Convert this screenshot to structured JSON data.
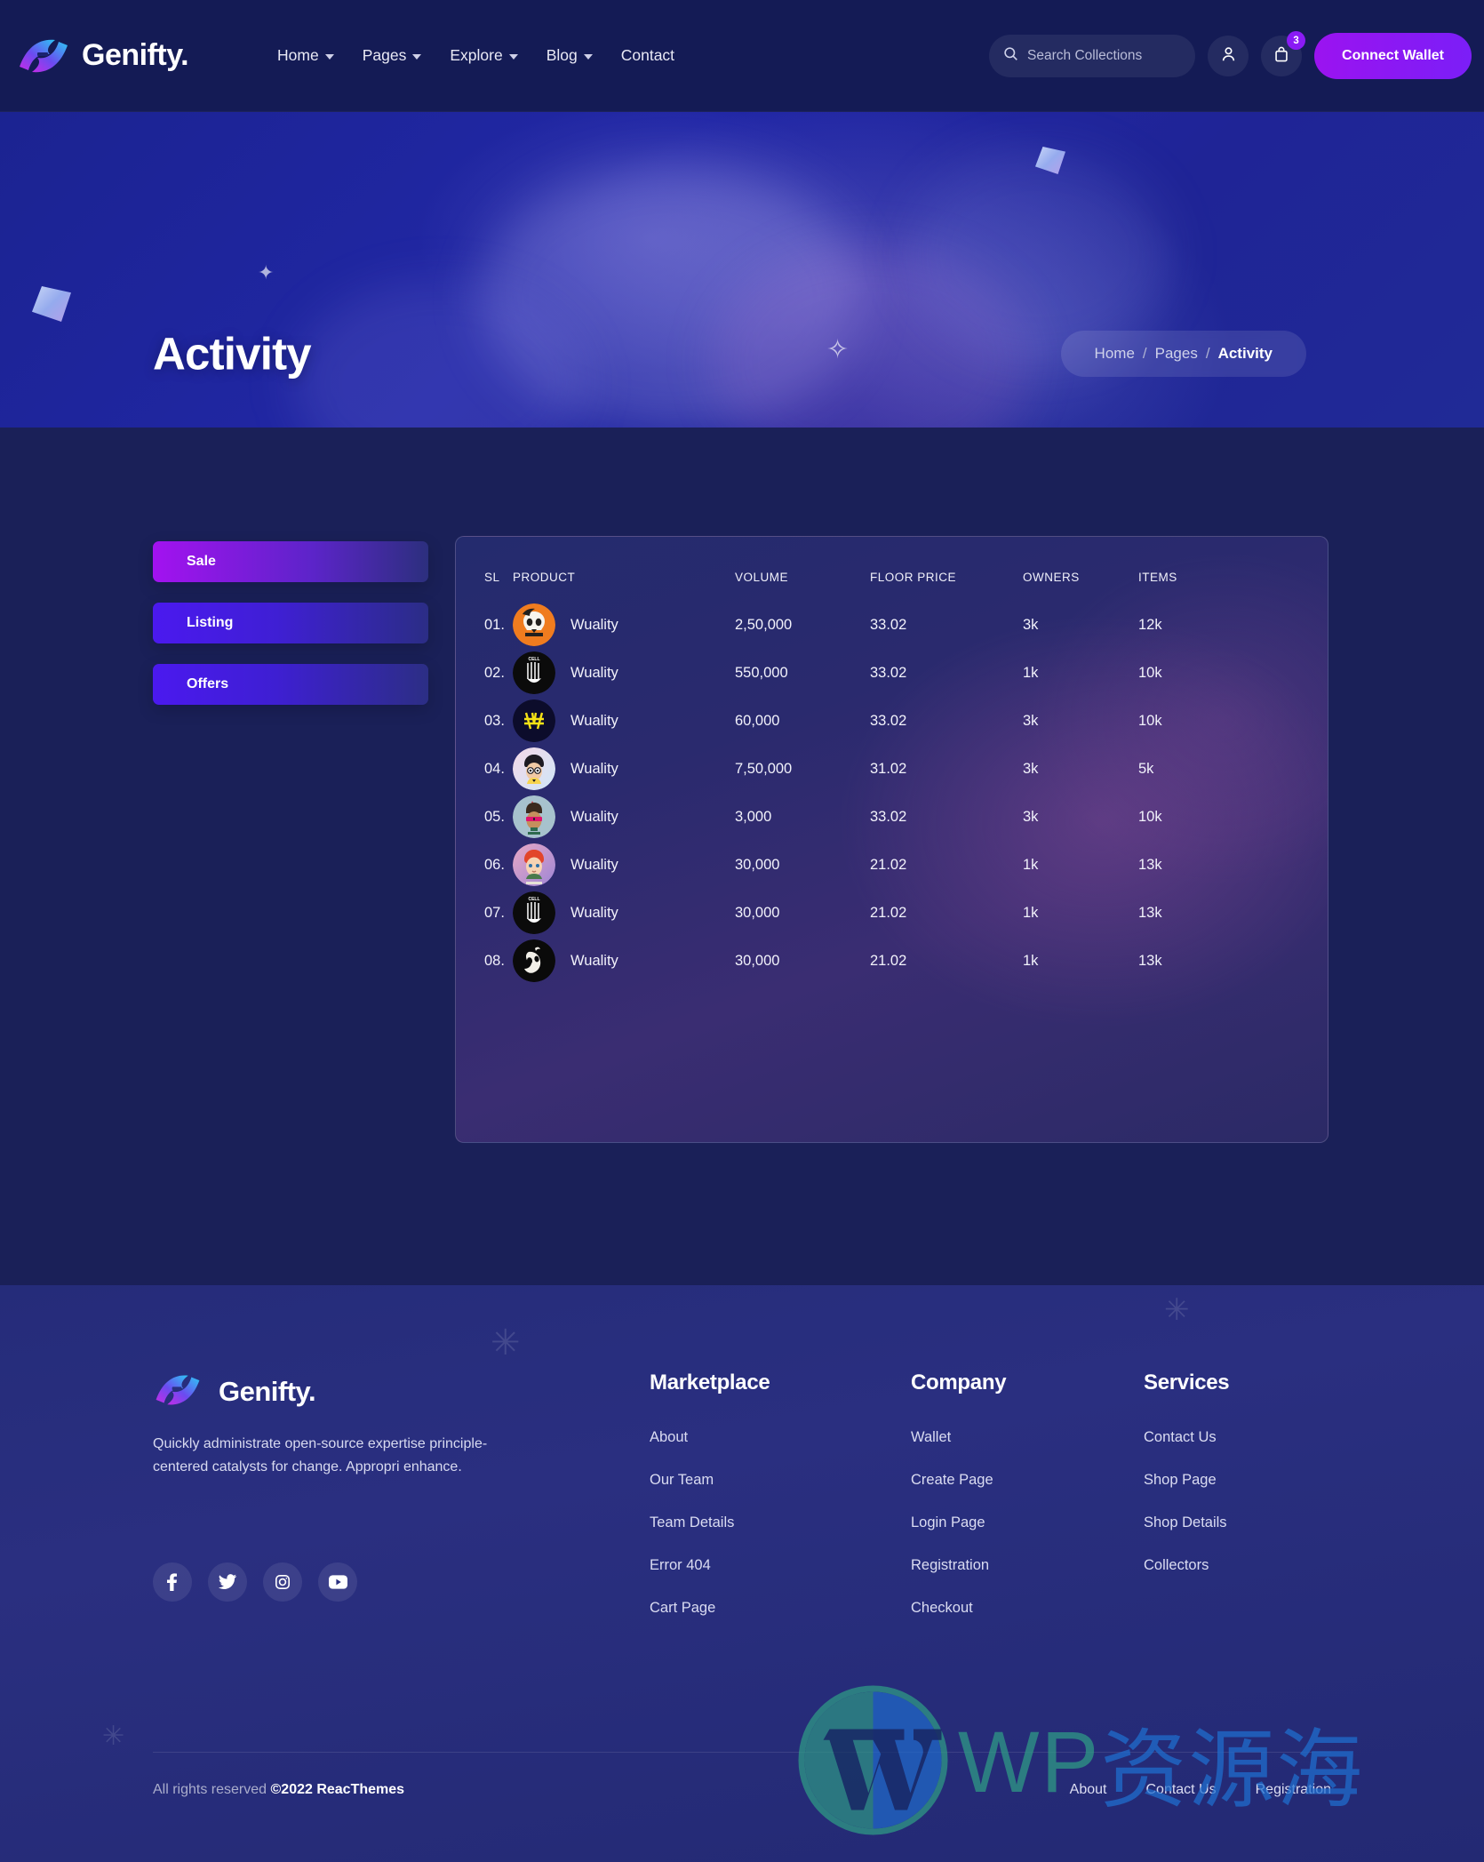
{
  "brand": {
    "name": "Genifty.",
    "logo_icon": "genifty-logo-icon"
  },
  "header": {
    "nav": [
      {
        "label": "Home",
        "has_dropdown": true
      },
      {
        "label": "Pages",
        "has_dropdown": true
      },
      {
        "label": "Explore",
        "has_dropdown": true
      },
      {
        "label": "Blog",
        "has_dropdown": true
      },
      {
        "label": "Contact",
        "has_dropdown": false
      }
    ],
    "search": {
      "placeholder": "Search Collections",
      "value": "",
      "icon": "search-icon"
    },
    "account_icon": "user-icon",
    "cart_icon": "shopping-bag-icon",
    "cart_badge": "3",
    "connect_wallet_label": "Connect Wallet",
    "accent": "#8a1bf5"
  },
  "hero": {
    "title": "Activity",
    "breadcrumb": [
      {
        "label": "Home",
        "current": false
      },
      {
        "label": "Pages",
        "current": false
      },
      {
        "label": "Activity",
        "current": true
      }
    ],
    "separator": "/",
    "coin_symbol": "₿"
  },
  "main": {
    "tabs": [
      {
        "label": "Sale",
        "active": true,
        "class": "sale"
      },
      {
        "label": "Listing",
        "active": false,
        "class": "listing"
      },
      {
        "label": "Offers",
        "active": false,
        "class": "offers"
      }
    ],
    "table": {
      "columns": [
        "SL",
        "PRODUCT",
        "VOLUME",
        "FLOOR PRICE",
        "OWNERS",
        "ITEMS"
      ],
      "rows": [
        {
          "sl": "01.",
          "product": "Wuality",
          "volume": "2,50,000",
          "floor_price": "33.02",
          "owners": "3k",
          "items": "12k",
          "avatar": "skull-orange-avatar"
        },
        {
          "sl": "02.",
          "product": "Wuality",
          "volume": "550,000",
          "floor_price": "33.02",
          "owners": "1k",
          "items": "10k",
          "avatar": "cell-mates-black-avatar"
        },
        {
          "sl": "03.",
          "product": "Wuality",
          "volume": "60,000",
          "floor_price": "33.02",
          "owners": "3k",
          "items": "10k",
          "avatar": "yellow-won-avatar"
        },
        {
          "sl": "04.",
          "product": "Wuality",
          "volume": "7,50,000",
          "floor_price": "31.02",
          "owners": "3k",
          "items": "5k",
          "avatar": "boy-cartoon-avatar"
        },
        {
          "sl": "05.",
          "product": "Wuality",
          "volume": "3,000",
          "floor_price": "33.02",
          "owners": "3k",
          "items": "10k",
          "avatar": "punk-sunglasses-avatar"
        },
        {
          "sl": "06.",
          "product": "Wuality",
          "volume": "30,000",
          "floor_price": "21.02",
          "owners": "1k",
          "items": "13k",
          "avatar": "redhead-boy-avatar"
        },
        {
          "sl": "07.",
          "product": "Wuality",
          "volume": "30,000",
          "floor_price": "21.02",
          "owners": "1k",
          "items": "13k",
          "avatar": "cell-mates-black-avatar"
        },
        {
          "sl": "08.",
          "product": "Wuality",
          "volume": "30,000",
          "floor_price": "21.02",
          "owners": "1k",
          "items": "13k",
          "avatar": "skull-black-avatar"
        }
      ]
    }
  },
  "footer": {
    "description": "Quickly administrate open-source expertise principle-centered catalysts for change. Appropri enhance.",
    "socials": [
      {
        "name": "facebook-icon",
        "glyph": "f"
      },
      {
        "name": "twitter-icon",
        "glyph": "t"
      },
      {
        "name": "instagram-icon",
        "glyph": "i"
      },
      {
        "name": "youtube-icon",
        "glyph": "y"
      }
    ],
    "columns": [
      {
        "title": "Marketplace",
        "links": [
          "About",
          "Our Team",
          "Team Details",
          "Error 404",
          "Cart Page"
        ]
      },
      {
        "title": "Company",
        "links": [
          "Wallet",
          "Create Page",
          "Login Page",
          "Registration",
          "Checkout"
        ]
      },
      {
        "title": "Services",
        "links": [
          "Contact Us",
          "Shop Page",
          "Shop Details",
          "Collectors"
        ]
      }
    ],
    "copyright_prefix": "All rights reserved ",
    "copyright_strong": "©2022 ReacThemes",
    "bottom_links": [
      "About",
      "Contact Us",
      "Registration"
    ]
  },
  "watermark": {
    "latin": "WP",
    "chinese": "资源海",
    "logo_icon": "wordpress-logo-icon"
  }
}
